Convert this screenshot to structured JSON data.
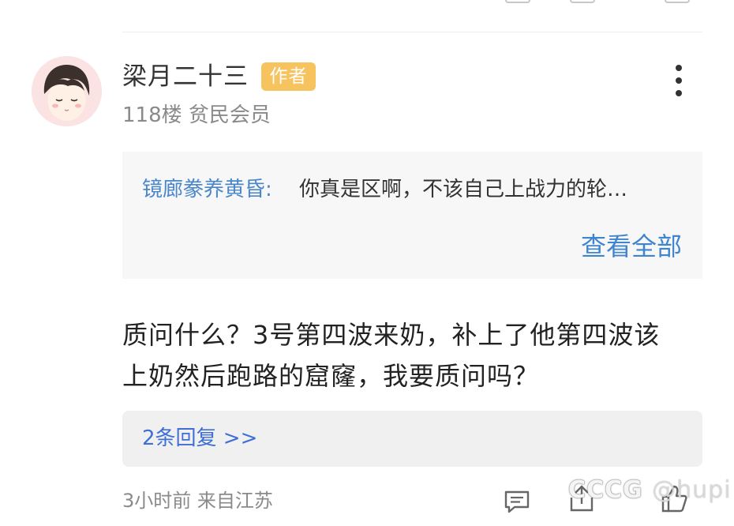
{
  "post": {
    "username": "梁月二十三",
    "author_badge": "作者",
    "floor": "118楼",
    "rank": "贫民会员"
  },
  "quote": {
    "author": "镜廊豢养黄昏:",
    "text": "你真是区啊，不该自己上战力的轮…",
    "view_all": "查看全部"
  },
  "body": {
    "line1": "质问什么？3号第四波来奶，补上了他第四波该",
    "line2": "上奶然后跑路的窟窿，我要质问吗？"
  },
  "replies": {
    "label": "2条回复 >>"
  },
  "footer": {
    "meta": "3小时前 来自江苏"
  },
  "watermark": {
    "brand": "CCCG",
    "handle": "@hupi"
  },
  "icons": {
    "more": "more-vertical-icon",
    "comment": "comment-icon",
    "share": "share-icon",
    "like": "thumbs-up-icon"
  },
  "colors": {
    "badge": "#f7c35e",
    "link": "#3f84cf",
    "quote_author": "#4a87c9",
    "quote_bg": "#f7f7f7",
    "replies_bg": "#f0f0f0"
  }
}
